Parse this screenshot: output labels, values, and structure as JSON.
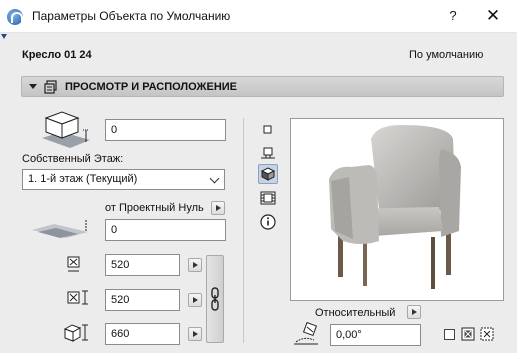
{
  "window": {
    "title": "Параметры Объекта по Умолчанию",
    "help_label": "?",
    "close_label": "✕"
  },
  "object": {
    "name": "Кресло 01 24",
    "default_label": "По умолчанию"
  },
  "section": {
    "title": "ПРОСМОТР И РАСПОЛОЖЕНИЕ",
    "icon": "floor-plan-icon"
  },
  "fields": {
    "elevation_value": "0",
    "home_story_label": "Собственный Этаж:",
    "home_story_value": "1. 1-й этаж (Текущий)",
    "reference_label": "от Проектный Нуль",
    "reference_value": "0",
    "width_value": "520",
    "depth_value": "520",
    "height_value": "660",
    "rotation_mode_label": "Относительный",
    "rotation_value": "0,00°"
  },
  "view_buttons": [
    {
      "name": "plan-view-icon",
      "active": false
    },
    {
      "name": "section-view-icon",
      "active": false
    },
    {
      "name": "3d-view-icon",
      "active": true
    },
    {
      "name": "film-view-icon",
      "active": false
    },
    {
      "name": "info-icon",
      "active": false
    }
  ],
  "colors": {
    "title_bg": "#ffffff",
    "panel_bg": "#ececec",
    "section_bg": "#cfcfcf",
    "active_tool": "#c8d4e4"
  }
}
